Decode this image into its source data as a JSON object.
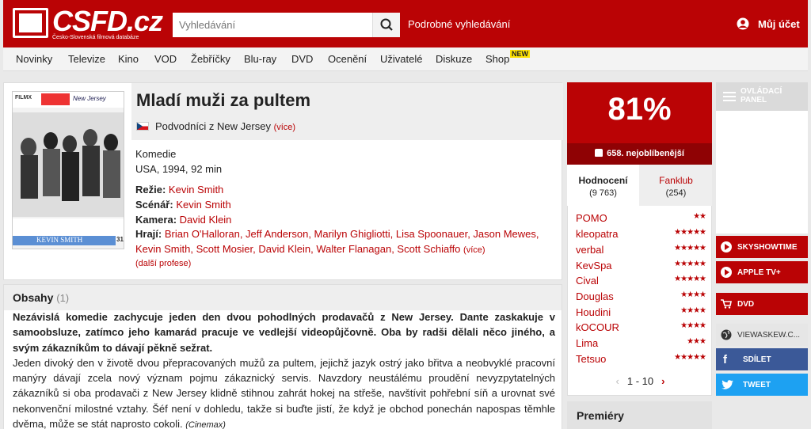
{
  "header": {
    "logo_text": "CSFD.cz",
    "logo_sub": "Česko-Slovenská filmová databáze",
    "search_placeholder": "Vyhledávání",
    "advanced_search": "Podrobné vyhledávání",
    "account": "Můj účet"
  },
  "nav": {
    "items": [
      "Novinky",
      "Televize",
      "Kino",
      "VOD",
      "Žebříčky",
      "Blu-ray",
      "DVD",
      "Ocenění",
      "Uživatelé",
      "Diskuze",
      "Shop"
    ],
    "shop_badge": "NEW"
  },
  "film": {
    "title": "Mladí muži za pultem",
    "alt_title": "Podvodníci z New Jersey",
    "alt_more": "(více)",
    "genre": "Komedie",
    "origin": "USA, 1994, 92 min",
    "director_label": "Režie:",
    "director": "Kevin Smith",
    "writer_label": "Scénář:",
    "writer": "Kevin Smith",
    "camera_label": "Kamera:",
    "camera": "David Klein",
    "cast_label": "Hrají:",
    "cast_line1": "Brian O'Halloran, Jeff Anderson, Marilyn Ghigliotti, Lisa Spoonauer, Jason Mewes,",
    "cast_line2": "Kevin Smith, Scott Mosier, David Klein, Walter Flanagan, Scott Schiaffo",
    "cast_more": "(více)",
    "more_professions": "(další profese)",
    "poster_top_left": "FILMX",
    "poster_top_right": "New Jersey",
    "poster_bottom": "KEVIN SMITH",
    "poster_num": "31"
  },
  "plot": {
    "title": "Obsahy",
    "count": "(1)",
    "bold_text": "Nezávislá komedie zachycuje jeden den dvou pohodlných prodavačů z New Jersey. Dante zaskakuje v samoobsluze, zatímco jeho kamarád pracuje ve vedlejší videopůjčovně. Oba by radši dělali něco jiného, a svým zákazníkům to dávají pěkně sežrat.",
    "text": "Jeden divoký den v životě dvou přepracovaných mužů za pultem, jejichž jazyk ostrý jako břitva a neobvyklé pracovní manýry dávají zcela nový význam pojmu zákaznický servis. Navzdory neustálému proudění nevyzpytatelných zákazníků si oba prodavači z New Jersey klidně stihnou zahrát hokej na střeše, navštívit pohřební síň a urovnat své nekonvenční milostné vztahy. Šéf není v dohledu, takže si buďte jistí, že když je obchod ponechán napospas těmhle dvěma, může se stát naprosto cokoli.",
    "source": "(Cinemax)"
  },
  "rating": {
    "percent": "81%",
    "rank": "658. nejoblíbenější",
    "tab_ratings": "Hodnocení",
    "tab_ratings_count": "(9 763)",
    "tab_fanclub": "Fanklub",
    "tab_fanclub_count": "(254)",
    "users": [
      {
        "name": "POMO",
        "stars": "★★"
      },
      {
        "name": "kleopatra",
        "stars": "★★★★★"
      },
      {
        "name": "verbal",
        "stars": "★★★★★"
      },
      {
        "name": "KevSpa",
        "stars": "★★★★★"
      },
      {
        "name": "Cival",
        "stars": "★★★★★"
      },
      {
        "name": "Douglas",
        "stars": "★★★★"
      },
      {
        "name": "Houdini",
        "stars": "★★★★"
      },
      {
        "name": "kOCOUR",
        "stars": "★★★★"
      },
      {
        "name": "Lima",
        "stars": "★★★"
      },
      {
        "name": "Tetsuo",
        "stars": "★★★★★"
      }
    ],
    "pager": "1 - 10"
  },
  "premiery": "Premiéry",
  "right": {
    "control_panel_1": "OVLÁDACÍ",
    "control_panel_2": "PANEL",
    "skyshowtime": "SKYSHOWTIME",
    "appletv": "APPLE TV+",
    "dvd": "DVD",
    "viewaskew": "VIEWASKEW.C...",
    "share": "SDÍLET",
    "tweet": "TWEET"
  },
  "colors": {
    "brand": "#ba0305",
    "facebook": "#3b5998",
    "twitter": "#1da1f2"
  }
}
